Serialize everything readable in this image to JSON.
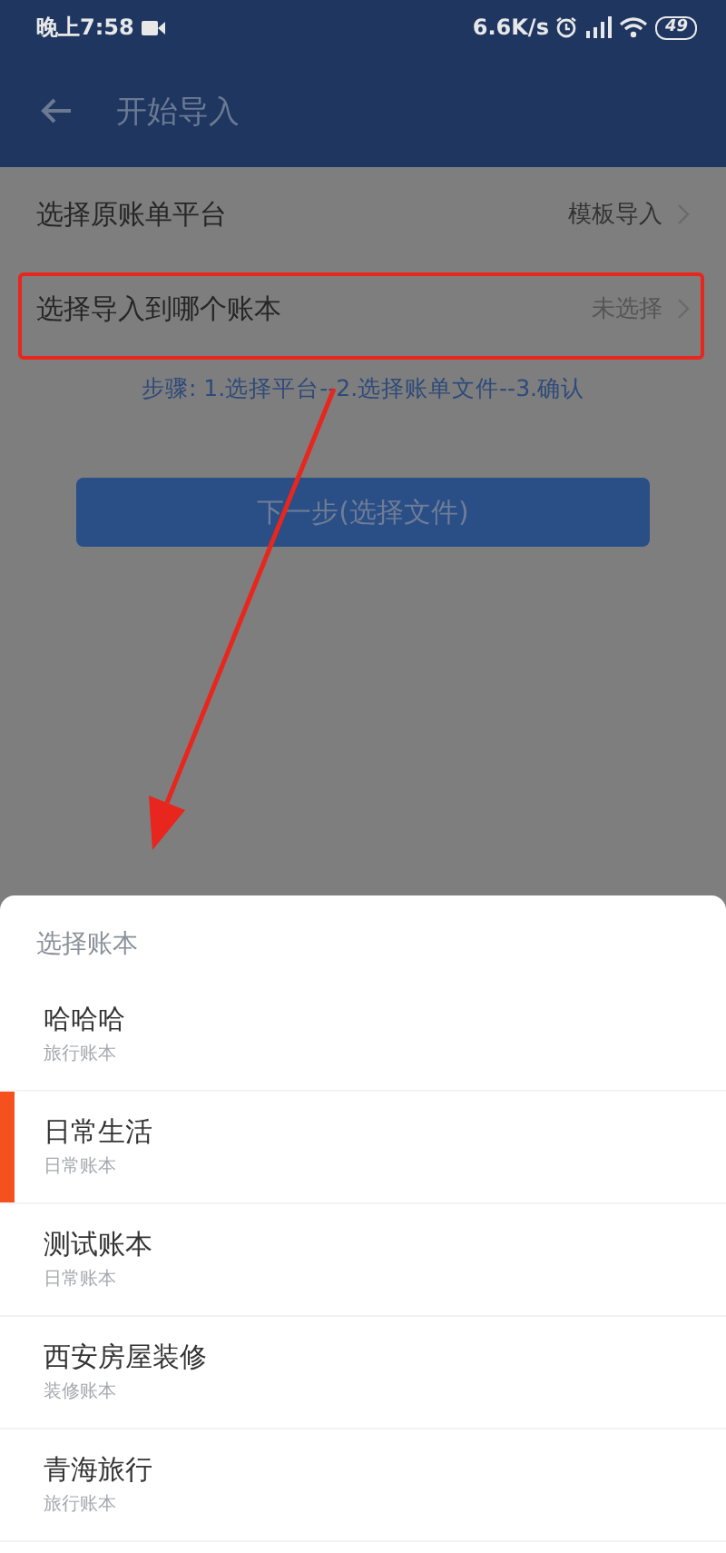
{
  "status_bar": {
    "time": "晚上7:58",
    "speed": "6.6K/s",
    "battery": "49"
  },
  "toolbar": {
    "title": "开始导入"
  },
  "rows": [
    {
      "label": "选择原账单平台",
      "value": "模板导入"
    },
    {
      "label": "选择导入到哪个账本",
      "value": "未选择"
    }
  ],
  "steps": "步骤: 1.选择平台--2.选择账单文件--3.确认",
  "next_button": "下一步(选择文件)",
  "sheet": {
    "title": "选择账本",
    "items": [
      {
        "name": "哈哈哈",
        "type": "旅行账本",
        "selected": false
      },
      {
        "name": "日常生活",
        "type": "日常账本",
        "selected": true
      },
      {
        "name": "测试账本",
        "type": "日常账本",
        "selected": false
      },
      {
        "name": "西安房屋装修",
        "type": "装修账本",
        "selected": false
      },
      {
        "name": "青海旅行",
        "type": "旅行账本",
        "selected": false
      }
    ]
  }
}
